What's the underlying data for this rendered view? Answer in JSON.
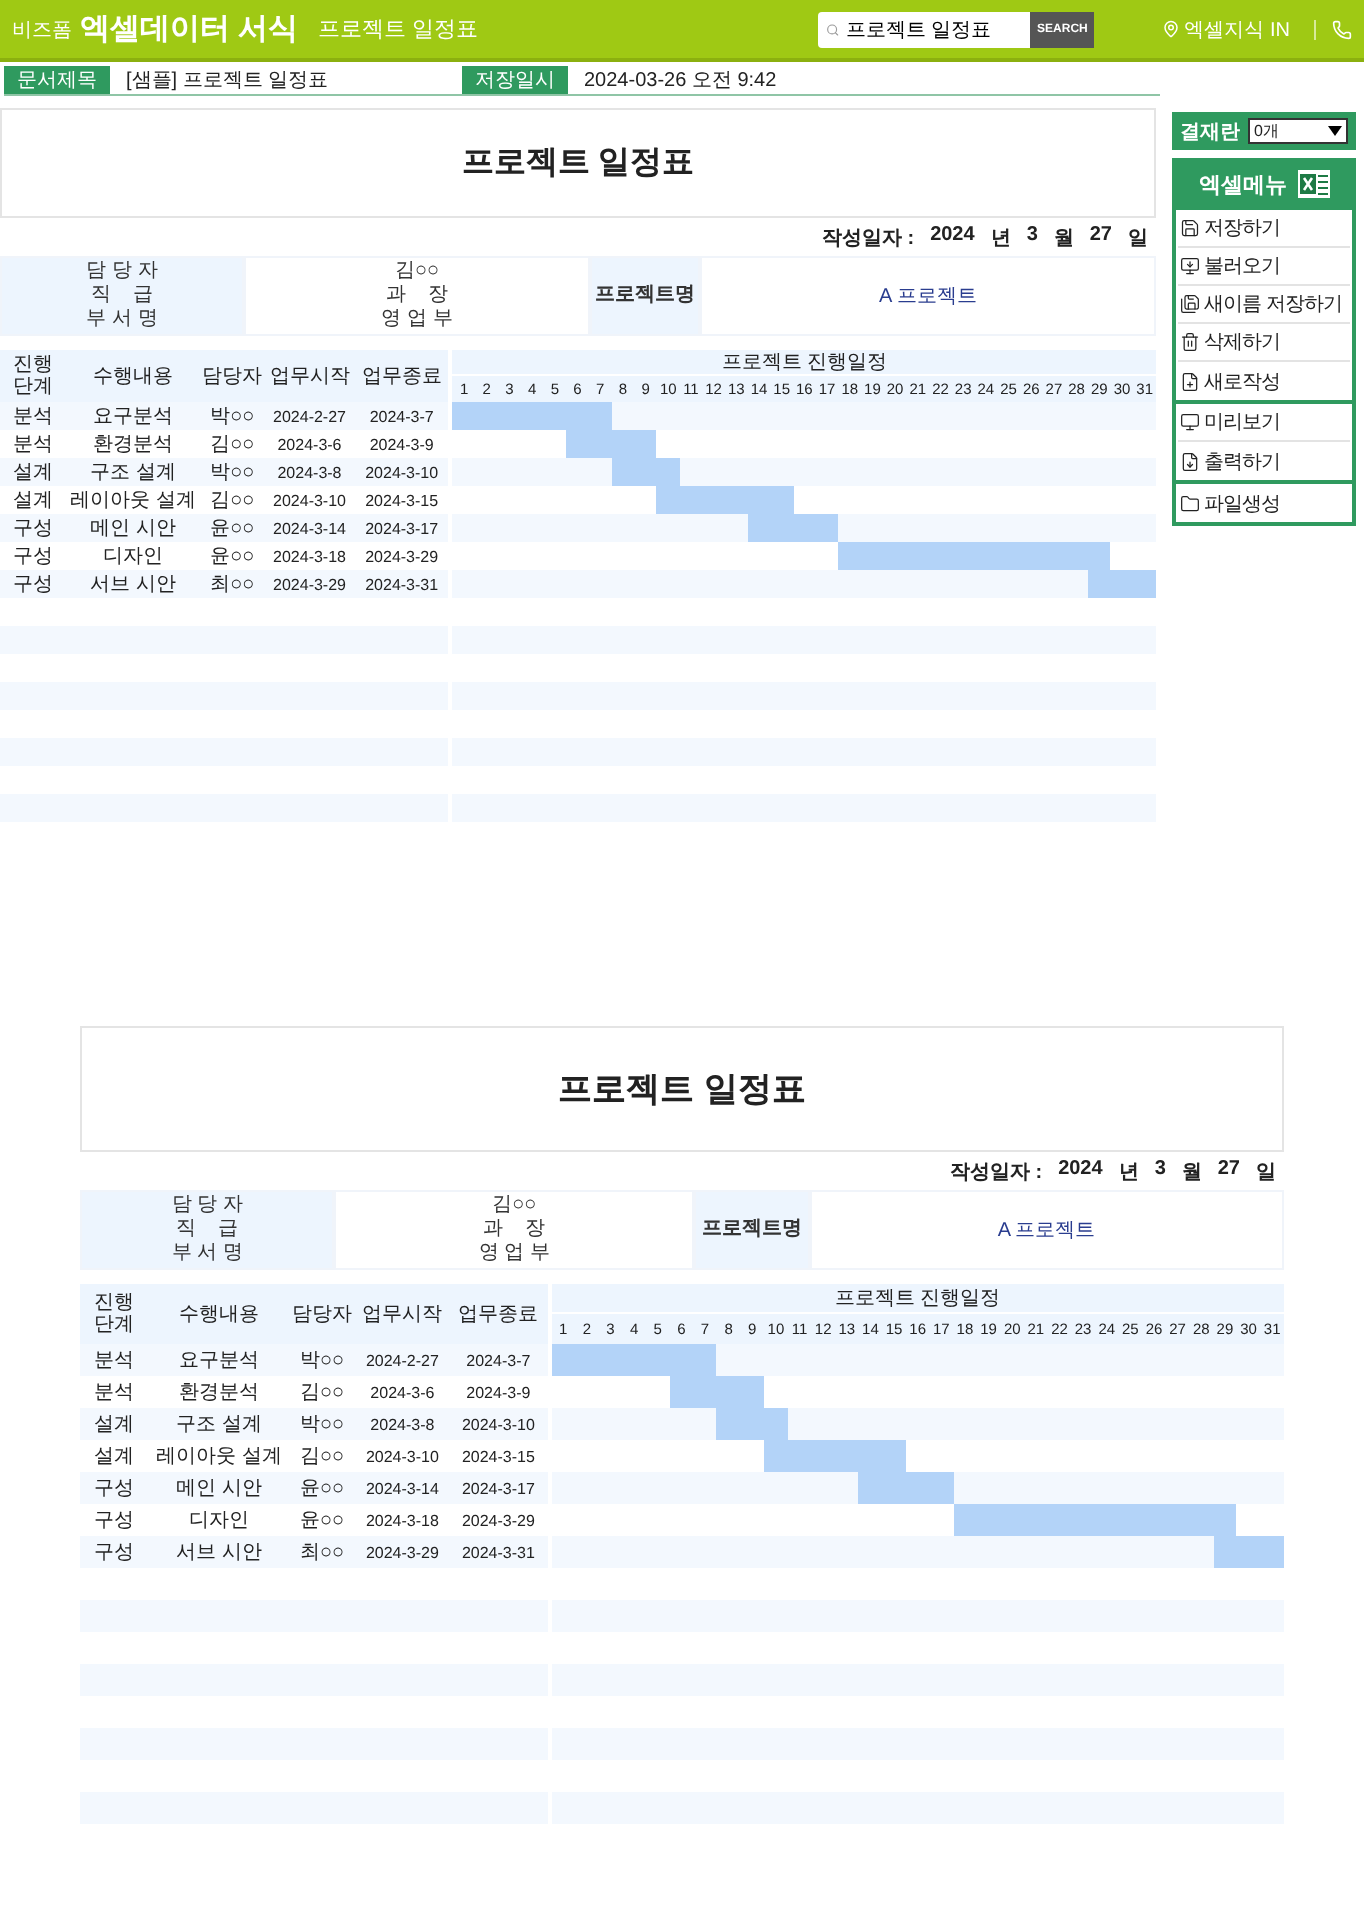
{
  "header": {
    "logo_small": "비즈폼",
    "logo": "엑셀데이터 서식",
    "page_title": "프로젝트 일정표",
    "search": {
      "value": "프로젝트 일정표",
      "button": "SEARCH"
    },
    "link": "엑셀지식 IN"
  },
  "doc_bar": [
    {
      "label": "문서제목",
      "value": "[샘플] 프로젝트 일정표"
    },
    {
      "label": "저장일시",
      "value": "2024-03-26  오전 9:42"
    }
  ],
  "side_panel": {
    "approval": {
      "label": "결재란",
      "select": "0개"
    },
    "menu": {
      "title": "엑셀메뉴",
      "groups": [
        {
          "items": [
            {
              "label": "저장하기"
            },
            {
              "label": "불러오기"
            },
            {
              "label": "새이름 저장하기"
            },
            {
              "label": "삭제하기"
            },
            {
              "label": "새로작성"
            }
          ]
        },
        {
          "items": [
            {
              "label": "미리보기"
            },
            {
              "label": "출력하기"
            }
          ]
        },
        {
          "items": [
            {
              "label": "파일생성"
            }
          ]
        }
      ]
    }
  },
  "documents": [
    {
      "title": "프로젝트 일정표",
      "date": {
        "label": "작성일자 :",
        "parts": [
          {
            "value": "2024",
            "unit": "년"
          },
          {
            "value": "3",
            "unit": "월"
          },
          {
            "value": "27",
            "unit": "일"
          }
        ]
      },
      "info": {
        "labels": [
          "담 당 자",
          "직    급",
          "부 서 명"
        ],
        "values": [
          "김○○",
          "과    장",
          "영 업 부"
        ],
        "project_label": "프로젝트명",
        "project_value": "A 프로젝트"
      },
      "gantt": {
        "columns": [
          "진행\n단계",
          "수행내용",
          "담당자",
          "업무시작",
          "업무종료"
        ],
        "schedule_title": "프로젝트 진행일정",
        "days": [
          "1",
          "2",
          "3",
          "4",
          "5",
          "6",
          "7",
          "8",
          "9",
          "10",
          "11",
          "12",
          "13",
          "14",
          "15",
          "16",
          "17",
          "18",
          "19",
          "20",
          "21",
          "22",
          "23",
          "24",
          "25",
          "26",
          "27",
          "28",
          "29",
          "30",
          "31"
        ],
        "rows": [
          {
            "stage": "분석",
            "task": "요구분석",
            "owner": "박○○",
            "start": "2024-2-27",
            "end": "2024-3-7"
          },
          {
            "stage": "분석",
            "task": "환경분석",
            "owner": "김○○",
            "start": "2024-3-6",
            "end": "2024-3-9"
          },
          {
            "stage": "설계",
            "task": "구조 설계",
            "owner": "박○○",
            "start": "2024-3-8",
            "end": "2024-3-10"
          },
          {
            "stage": "설계",
            "task": "레이아웃 설계",
            "owner": "김○○",
            "start": "2024-3-10",
            "end": "2024-3-15"
          },
          {
            "stage": "구성",
            "task": "메인 시안",
            "owner": "윤○○",
            "start": "2024-3-14",
            "end": "2024-3-17"
          },
          {
            "stage": "구성",
            "task": "디자인",
            "owner": "윤○○",
            "start": "2024-3-18",
            "end": "2024-3-29"
          },
          {
            "stage": "구성",
            "task": "서브 시안",
            "owner": "최○○",
            "start": "2024-3-29",
            "end": "2024-3-31"
          }
        ]
      }
    },
    {
      "title": "프로젝트 일정표",
      "date": {
        "label": "작성일자 :",
        "parts": [
          {
            "value": "2024",
            "unit": "년"
          },
          {
            "value": "3",
            "unit": "월"
          },
          {
            "value": "27",
            "unit": "일"
          }
        ]
      },
      "info": {
        "labels": [
          "담 당 자",
          "직    급",
          "부 서 명"
        ],
        "values": [
          "김○○",
          "과    장",
          "영 업 부"
        ],
        "project_label": "프로젝트명",
        "project_value": "A 프로젝트"
      },
      "gantt": {
        "columns": [
          "진행\n단계",
          "수행내용",
          "담당자",
          "업무시작",
          "업무종료"
        ],
        "schedule_title": "프로젝트 진행일정",
        "days": [
          "1",
          "2",
          "3",
          "4",
          "5",
          "6",
          "7",
          "8",
          "9",
          "10",
          "11",
          "12",
          "13",
          "14",
          "15",
          "16",
          "17",
          "18",
          "19",
          "20",
          "21",
          "22",
          "23",
          "24",
          "25",
          "26",
          "27",
          "28",
          "29",
          "30",
          "31"
        ],
        "rows": [
          {
            "stage": "분석",
            "task": "요구분석",
            "owner": "박○○",
            "start": "2024-2-27",
            "end": "2024-3-7"
          },
          {
            "stage": "분석",
            "task": "환경분석",
            "owner": "김○○",
            "start": "2024-3-6",
            "end": "2024-3-9"
          },
          {
            "stage": "설계",
            "task": "구조 설계",
            "owner": "박○○",
            "start": "2024-3-8",
            "end": "2024-3-10"
          },
          {
            "stage": "설계",
            "task": "레이아웃 설계",
            "owner": "김○○",
            "start": "2024-3-10",
            "end": "2024-3-15"
          },
          {
            "stage": "구성",
            "task": "메인 시안",
            "owner": "윤○○",
            "start": "2024-3-14",
            "end": "2024-3-17"
          },
          {
            "stage": "구성",
            "task": "디자인",
            "owner": "윤○○",
            "start": "2024-3-18",
            "end": "2024-3-29"
          },
          {
            "stage": "구성",
            "task": "서브 시안",
            "owner": "최○○",
            "start": "2024-3-29",
            "end": "2024-3-31"
          }
        ]
      }
    }
  ]
}
